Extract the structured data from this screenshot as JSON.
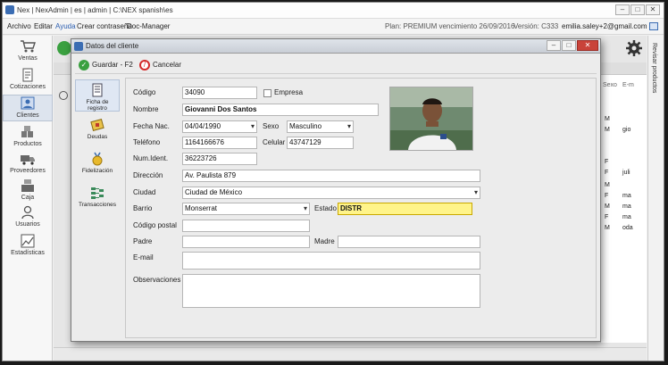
{
  "window": {
    "title": "Nex | NexAdmin | es | admin | C:\\NEX spanish\\es"
  },
  "menu": {
    "items": [
      "Archivo",
      "Editar",
      "Ayuda",
      "Crear contraseña",
      "Doc-Manager"
    ],
    "plan_text": "Plan: PREMIUM vencimiento 26/09/2016",
    "version_text": "Versión: C333",
    "email": "emilia.saley+2@gmail.com"
  },
  "nav": {
    "items": [
      {
        "label": "Ventas",
        "icon": "cart-icon"
      },
      {
        "label": "Cotizaciones",
        "icon": "document-icon"
      },
      {
        "label": "Clientes",
        "icon": "clients-icon"
      },
      {
        "label": "Productos",
        "icon": "boxes-icon"
      },
      {
        "label": "Proveedores",
        "icon": "truck-icon"
      },
      {
        "label": "Caja",
        "icon": "cash-register-icon"
      },
      {
        "label": "Usuarios",
        "icon": "user-icon"
      },
      {
        "label": "Estadísticas",
        "icon": "chart-icon"
      }
    ]
  },
  "right_panel": {
    "label": "Revisar productos"
  },
  "background_grid": {
    "header_sexo": "Sexo",
    "header_email": "E-m",
    "rows": [
      {
        "sexo": "M",
        "email": ""
      },
      {
        "sexo": "M",
        "email": "gio"
      },
      {
        "sexo": "F",
        "email": ""
      },
      {
        "sexo": "F",
        "email": "juli"
      },
      {
        "sexo": "M",
        "email": ""
      },
      {
        "sexo": "F",
        "email": "ma"
      },
      {
        "sexo": "M",
        "email": "ma"
      },
      {
        "sexo": "F",
        "email": "ma"
      },
      {
        "sexo": "M",
        "email": "oda"
      }
    ]
  },
  "dialog": {
    "title": "Datos del cliente",
    "save_label": "Guardar - F2",
    "cancel_label": "Cancelar",
    "side_tabs": [
      {
        "label": "Ficha de registro",
        "icon": "registration-card-icon"
      },
      {
        "label": "Deudas",
        "icon": "debts-icon"
      },
      {
        "label": "Fidelización",
        "icon": "medal-icon"
      },
      {
        "label": "Transacciones",
        "icon": "transactions-icon"
      }
    ],
    "form": {
      "codigo_label": "Código",
      "codigo": "34090",
      "empresa_label": "Empresa",
      "nombre_label": "Nombre",
      "nombre": "Giovanni Dos Santos",
      "fecha_label": "Fecha Nac.",
      "fecha": "04/04/1990",
      "sexo_label": "Sexo",
      "sexo": "Masculino",
      "telefono_label": "Teléfono",
      "telefono": "1164166676",
      "celular_label": "Celular",
      "celular": "43747129",
      "numident_label": "Num.Ident.",
      "numident": "36223726",
      "direccion_label": "Dirección",
      "direccion": "Av. Paulista 879",
      "ciudad_label": "Ciudad",
      "ciudad": "Ciudad de México",
      "barrio_label": "Barrio",
      "barrio": "Monserrat",
      "estado_label": "Estado",
      "estado": "DISTR",
      "cp_label": "Código postal",
      "cp": "",
      "padre_label": "Padre",
      "padre": "",
      "madre_label": "Madre",
      "madre": "",
      "email_label": "E-mail",
      "email": "",
      "obs_label": "Observaciones",
      "obs": ""
    }
  },
  "colors": {
    "highlight_field": "#fff48a",
    "save_green": "#3aa040",
    "cancel_red": "#d42a2a"
  }
}
